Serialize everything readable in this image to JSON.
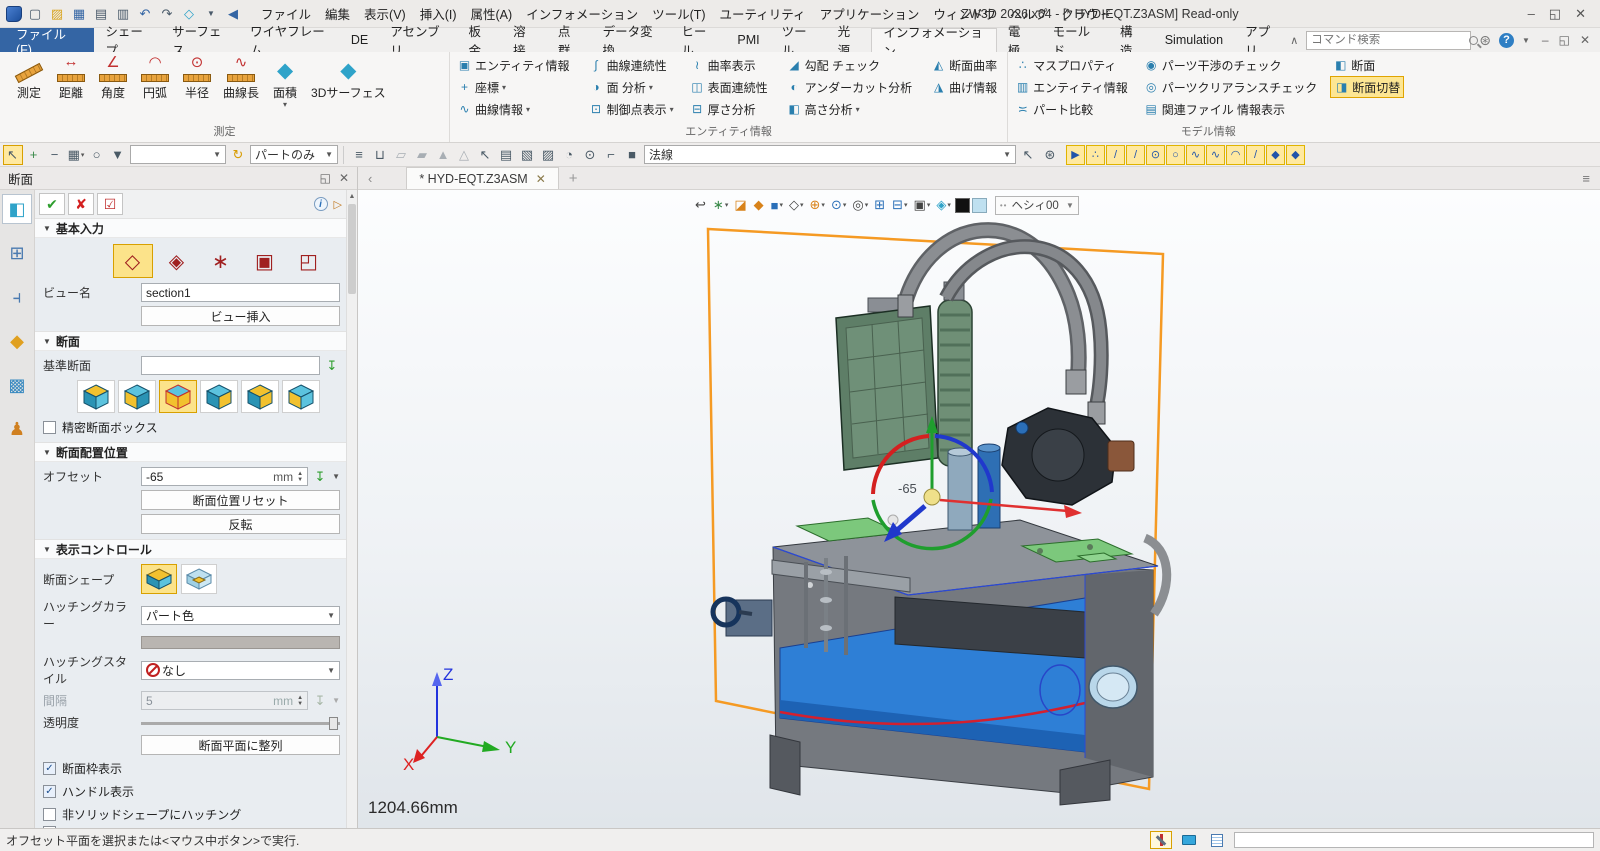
{
  "titlebar": {
    "title": "ZW3D 2026 x64  - [* HYD-EQT.Z3ASM] Read-only",
    "menu": [
      "ファイル",
      "編集",
      "表示(V)",
      "挿入(I)",
      "属性(A)",
      "インフォメーション",
      "ツール(T)",
      "ユーティリティ",
      "アプリケーション",
      "ウィンドウ",
      "ヘルプ",
      "クラウド"
    ]
  },
  "tabs": {
    "file": "ファイル(F)",
    "items": [
      {
        "name": "tab-shape",
        "label": "シェープ"
      },
      {
        "name": "tab-surface",
        "label": "サーフェス"
      },
      {
        "name": "tab-wireframe",
        "label": "ワイヤフレーム"
      },
      {
        "name": "tab-de",
        "label": "DE"
      },
      {
        "name": "tab-assembly",
        "label": "アセンブリ"
      },
      {
        "name": "tab-sheetmetal",
        "label": "板金"
      },
      {
        "name": "tab-weld",
        "label": "溶接"
      },
      {
        "name": "tab-pointcloud",
        "label": "点群"
      },
      {
        "name": "tab-dataexchange",
        "label": "データ変換"
      },
      {
        "name": "tab-heal",
        "label": "ヒール"
      },
      {
        "name": "tab-pmi",
        "label": "PMI"
      },
      {
        "name": "tab-tools",
        "label": "ツール"
      },
      {
        "name": "tab-light",
        "label": "光源"
      },
      {
        "name": "tab-information",
        "label": "インフォメーション",
        "cls": "active"
      },
      {
        "name": "tab-electrode",
        "label": "電極"
      },
      {
        "name": "tab-mold",
        "label": "モールド"
      },
      {
        "name": "tab-structure",
        "label": "構造"
      },
      {
        "name": "tab-simulation",
        "label": "Simulation"
      },
      {
        "name": "tab-apps",
        "label": "アプリ"
      }
    ],
    "search_placeholder": "コマンド検索"
  },
  "ribbon": {
    "measure": {
      "label": "測定",
      "items": [
        {
          "name": "measure-button",
          "label": "測定",
          "cls": "tilt"
        },
        {
          "name": "distance-button",
          "label": "距離",
          "glyph": "↔"
        },
        {
          "name": "angle-button",
          "label": "角度",
          "glyph": "∠"
        },
        {
          "name": "arc-button",
          "label": "円弧",
          "glyph": "◠"
        },
        {
          "name": "radius-button",
          "label": "半径",
          "glyph": "⊙"
        },
        {
          "name": "curve-length-button",
          "label": "曲線長",
          "glyph": "∿"
        },
        {
          "name": "area-button",
          "label": "面積",
          "glyph": "◆",
          "cls": "cube",
          "caret": "▾"
        },
        {
          "name": "surface-3d-button",
          "label": "3Dサーフェス",
          "glyph": "◆",
          "cls": "cube"
        }
      ]
    },
    "entity": {
      "label": "エンティティ情報",
      "items": [
        {
          "name": "entity-info-button",
          "label": "エンティティ情報",
          "glyph": "▣"
        },
        {
          "name": "coordinates-button",
          "label": "座標",
          "glyph": "+",
          "caret": "▾"
        },
        {
          "name": "curve-info-button",
          "label": "曲線情報",
          "glyph": "∿",
          "caret": "▾"
        },
        {
          "name": "curve-continuity-button",
          "label": "曲線連続性",
          "glyph": "∫"
        },
        {
          "name": "face-analysis-button",
          "label": "面 分析",
          "glyph": "◑",
          "caret": "▾"
        },
        {
          "name": "control-points-button",
          "label": "制御点表示",
          "glyph": "⊡",
          "caret": "▾"
        },
        {
          "name": "curvature-display-button",
          "label": "曲率表示",
          "glyph": "≀"
        },
        {
          "name": "surface-continuity-button",
          "label": "表面連続性",
          "glyph": "◫"
        },
        {
          "name": "thickness-analysis-button",
          "label": "厚さ分析",
          "glyph": "⊟"
        },
        {
          "name": "draft-check-button",
          "label": "勾配 チェック",
          "glyph": "◢"
        },
        {
          "name": "undercut-analysis-button",
          "label": "アンダーカット分析",
          "glyph": "◐"
        },
        {
          "name": "height-analysis-button",
          "label": "高さ分析",
          "glyph": "◧",
          "caret": "▾"
        },
        {
          "name": "section-curvature-button",
          "label": "断面曲率",
          "glyph": "◭"
        },
        {
          "name": "bend-info-button",
          "label": "曲げ情報",
          "glyph": "◮"
        }
      ]
    },
    "model": {
      "label": "モデル情報",
      "items": [
        {
          "name": "mass-properties-button",
          "label": "マスプロパティ",
          "glyph": "∴"
        },
        {
          "name": "entity-info2-button",
          "label": "エンティティ情報",
          "glyph": "▥"
        },
        {
          "name": "part-compare-button",
          "label": "パート比較",
          "glyph": "≍"
        },
        {
          "name": "interference-check-button",
          "label": "パーツ干渉のチェック",
          "glyph": "◉"
        },
        {
          "name": "clearance-check-button",
          "label": "パーツクリアランスチェック",
          "glyph": "◎"
        },
        {
          "name": "related-file-info-button",
          "label": "関連ファイル 情報表示",
          "glyph": "▤"
        },
        {
          "name": "section-button",
          "label": "断面",
          "glyph": "◧"
        },
        {
          "name": "section-toggle-button",
          "label": "断面切替",
          "glyph": "◨",
          "cls": "hl"
        }
      ]
    }
  },
  "toolbar": {
    "left": [
      {
        "name": "pick-cursor-icon",
        "glyph": "↖",
        "cls": "on"
      },
      {
        "name": "add-pick-icon",
        "glyph": "+",
        "cls": "c-green"
      },
      {
        "name": "remove-pick-icon",
        "glyph": "−"
      },
      {
        "name": "pick-list-icon",
        "glyph": "▦",
        "caret": "▾"
      },
      {
        "name": "lasso-pick-icon",
        "glyph": "○"
      },
      {
        "name": "filter-icon",
        "glyph": "▼"
      }
    ],
    "combo_empty": "",
    "cycle_icon": "↻",
    "combo_part": "パートのみ",
    "mid": [
      {
        "name": "pair-toggle-icon",
        "glyph": "≡"
      },
      {
        "name": "lock-icon",
        "glyph": "⊔"
      },
      {
        "name": "filter-shape-icon",
        "glyph": "▱",
        "cls": "dim"
      },
      {
        "name": "filter-face-icon",
        "glyph": "▰",
        "cls": "dim"
      },
      {
        "name": "filter-edge-icon",
        "glyph": "▲",
        "cls": "dim"
      },
      {
        "name": "filter-curve-icon",
        "glyph": "△",
        "cls": "dim"
      },
      {
        "name": "pick-arrow-icon",
        "glyph": "↖"
      },
      {
        "name": "manager-list-icon",
        "glyph": "▤"
      },
      {
        "name": "folder-part-icon",
        "glyph": "▧"
      },
      {
        "name": "folder-asm-icon",
        "glyph": "▨"
      },
      {
        "name": "session-icon",
        "glyph": "◔"
      },
      {
        "name": "history-icon",
        "glyph": "⊙"
      },
      {
        "name": "bracket-icon",
        "glyph": "⌐"
      },
      {
        "name": "black-box-icon",
        "glyph": "■"
      }
    ],
    "combo_normal": "法線",
    "snap": [
      {
        "name": "auto-snap-icon",
        "glyph": "▶"
      },
      {
        "name": "point-snap-icon",
        "glyph": "∴"
      },
      {
        "name": "line-snap-icon",
        "glyph": "/"
      },
      {
        "name": "mid-snap-icon",
        "glyph": "/"
      },
      {
        "name": "center-snap-icon",
        "glyph": "⊙"
      },
      {
        "name": "circle-snap-icon",
        "glyph": "○"
      },
      {
        "name": "spline-snap-icon",
        "glyph": "∿"
      },
      {
        "name": "curve-snap-icon",
        "glyph": "∿"
      },
      {
        "name": "arc-snap-icon",
        "glyph": "◠"
      },
      {
        "name": "tangent-snap-icon",
        "glyph": "/"
      },
      {
        "name": "face-snap-icon",
        "glyph": "◆"
      },
      {
        "name": "solid-snap-icon",
        "glyph": "◆"
      }
    ]
  },
  "panel": {
    "title": "断面",
    "sec_basic": "基本入力",
    "sec_section": "断面",
    "sec_place": "断面配置位置",
    "sec_display": "表示コントロール",
    "plane_options": [
      {
        "name": "one-plane-option",
        "glyph": "◇",
        "cls": "active"
      },
      {
        "name": "two-plane-option",
        "glyph": "◈"
      },
      {
        "name": "three-plane-option",
        "glyph": "∗"
      },
      {
        "name": "box-section-option",
        "glyph": "▣"
      },
      {
        "name": "corner-section-option",
        "glyph": "◰"
      }
    ],
    "view_name_label": "ビュー名",
    "view_name": "section1",
    "insert_view": "ビュー挿入",
    "base_label": "基準断面",
    "base_value": "",
    "precise_label": "精密断面ボックス",
    "offset_label": "オフセット",
    "offset_value": "-65",
    "unit": "mm",
    "reset": "断面位置リセット",
    "flip": "反転",
    "shape_label": "断面シェープ",
    "hatch_color_label": "ハッチングカラー",
    "hatch_color": "パート色",
    "hatch_style_label": "ハッチングスタイル",
    "hatch_style": "なし",
    "gap_label": "間隔",
    "gap_value": "5",
    "gap_unit": "mm",
    "transp_label": "透明度",
    "align": "断面平面に整列",
    "checks": [
      {
        "name": "check-section-frame",
        "label": "断面枠表示",
        "cls": "checked"
      },
      {
        "name": "check-handle-display",
        "label": "ハンドル表示",
        "cls": "checked"
      },
      {
        "name": "check-hatch-nonsolid",
        "label": "非ソリッドシェープにハッチング"
      }
    ]
  },
  "docbar": {
    "tab": "* HYD-EQT.Z3ASM"
  },
  "vptoolbar": {
    "items": [
      {
        "name": "exit-icon",
        "glyph": "↩",
        "cls": "c-dark"
      },
      {
        "name": "regen-icon",
        "glyph": "∗",
        "cls": "c-green",
        "caret": "▾"
      },
      {
        "name": "erase-icon",
        "glyph": "◪",
        "cls": "c-orange"
      },
      {
        "name": "datum-icon",
        "glyph": "◆",
        "cls": "c-orange"
      },
      {
        "name": "shaded-cube-icon",
        "glyph": "■",
        "cls": "c-blue",
        "caret": "▾"
      },
      {
        "name": "wireframe-cube-icon",
        "glyph": "◇",
        "cls": "c-dark",
        "caret": "▾"
      },
      {
        "name": "render-sphere-icon",
        "glyph": "⊕",
        "cls": "c-orange",
        "caret": "▾"
      },
      {
        "name": "zoom-window-icon",
        "glyph": "⊙",
        "cls": "c-blue",
        "caret": "▾"
      },
      {
        "name": "target-icon",
        "glyph": "◎",
        "cls": "c-dark",
        "caret": "▾"
      },
      {
        "name": "window-icon",
        "glyph": "⊞",
        "cls": "c-blue"
      },
      {
        "name": "hsplit-icon",
        "glyph": "⊟",
        "cls": "c-blue",
        "caret": "▾"
      },
      {
        "name": "display-monitor-icon",
        "glyph": "▣",
        "cls": "c-dark",
        "caret": "▾"
      },
      {
        "name": "layer-stack-icon",
        "glyph": "◈",
        "cls": "c-teal",
        "caret": "▾"
      }
    ],
    "layer": "ヘシィ00"
  },
  "viewport": {
    "measurement": "1204.66mm",
    "offset_label": "-65",
    "axis_x": "X",
    "axis_y": "Y",
    "axis_z": "Z"
  },
  "statusbar": {
    "message": "オフセット平面を選択または<マウス中ボタン>で実行."
  },
  "icons": {
    "help": "?",
    "info": "i",
    "bulbs": "••"
  },
  "colors": {
    "accent_blue": "#3465a4",
    "highlight_yellow": "#fde693",
    "section_orange": "#f59a23",
    "cut_blue": "#2e7fd6",
    "model_green": "#7cc87c",
    "handle_red": "#d42020",
    "handle_green": "#1f9e2e",
    "handle_blue": "#2038cc"
  }
}
